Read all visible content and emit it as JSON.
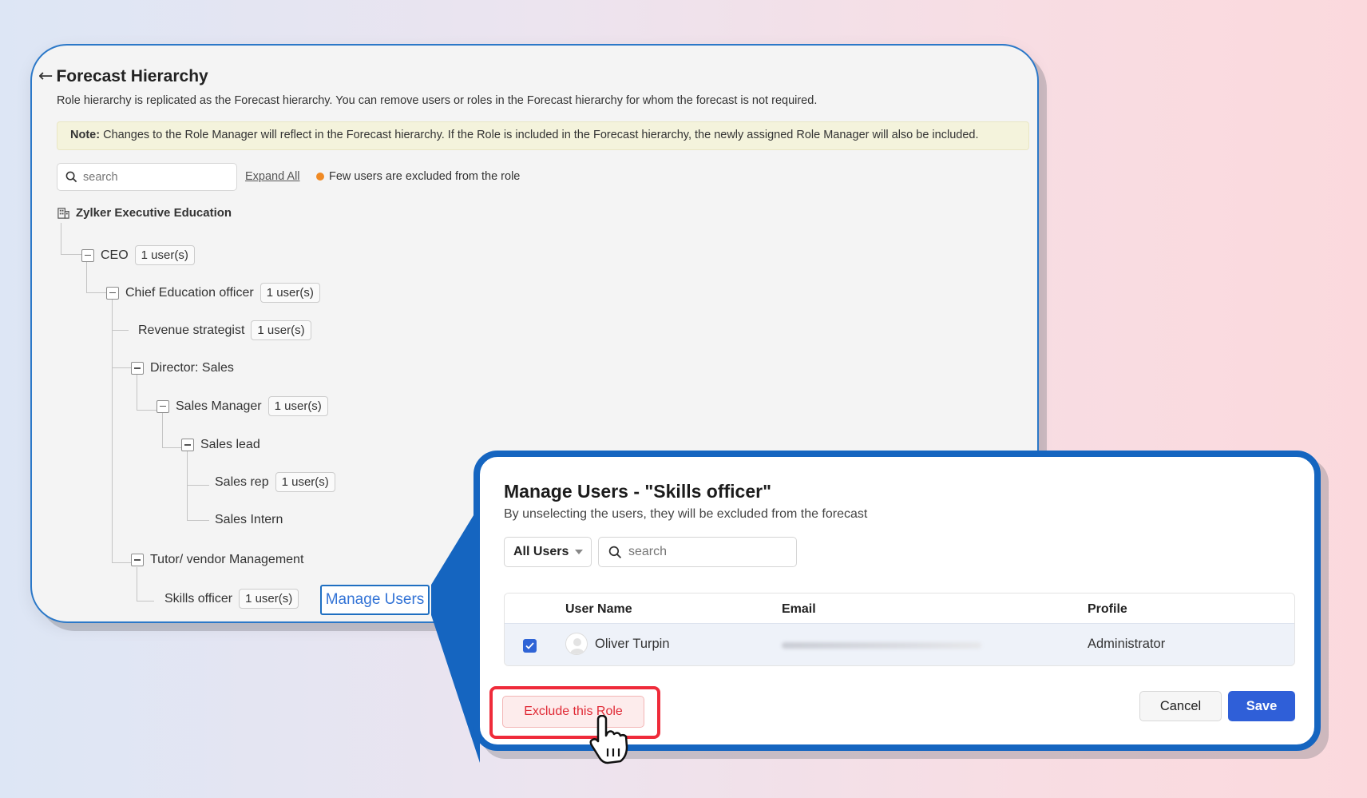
{
  "hierarchy": {
    "title": "Forecast Hierarchy",
    "subtitle": "Role hierarchy is replicated as the Forecast hierarchy. You can remove users or roles in the Forecast hierarchy for whom the forecast is not required.",
    "note_label": "Note:",
    "note_text": " Changes to the Role Manager will reflect in the Forecast hierarchy. If the Role is included in the Forecast hierarchy, the newly assigned Role Manager will also be included.",
    "search_placeholder": "search",
    "expand_all": "Expand All",
    "legend_text": "Few users are excluded from the role",
    "legend_color": "#f08a24",
    "org_name": "Zylker Executive Education",
    "nodes": [
      {
        "label": "CEO",
        "badge": "1 user(s)"
      },
      {
        "label": "Chief Education officer",
        "badge": "1 user(s)"
      },
      {
        "label": "Revenue strategist",
        "badge": "1 user(s)"
      },
      {
        "label": "Director: Sales",
        "badge": ""
      },
      {
        "label": "Sales Manager",
        "badge": "1 user(s)"
      },
      {
        "label": "Sales lead",
        "badge": ""
      },
      {
        "label": "Sales rep",
        "badge": "1 user(s)"
      },
      {
        "label": "Sales Intern",
        "badge": ""
      },
      {
        "label": "Tutor/ vendor Management",
        "badge": ""
      },
      {
        "label": "Skills officer",
        "badge": "1 user(s)"
      }
    ],
    "manage_users_link": "Manage Users"
  },
  "modal": {
    "title": "Manage Users - \"Skills officer\"",
    "subtitle": "By unselecting the users, they will be excluded from the forecast",
    "filter_value": "All Users",
    "search_placeholder": "search",
    "columns": [
      "User Name",
      "Email",
      "Profile"
    ],
    "rows": [
      {
        "checked": true,
        "user_name": "Oliver Turpin",
        "email": "",
        "profile": "Administrator"
      }
    ],
    "exclude_button": "Exclude this Role",
    "cancel_button": "Cancel",
    "save_button": "Save",
    "accent_color": "#1565c0",
    "danger_color": "#ef2b3a"
  }
}
